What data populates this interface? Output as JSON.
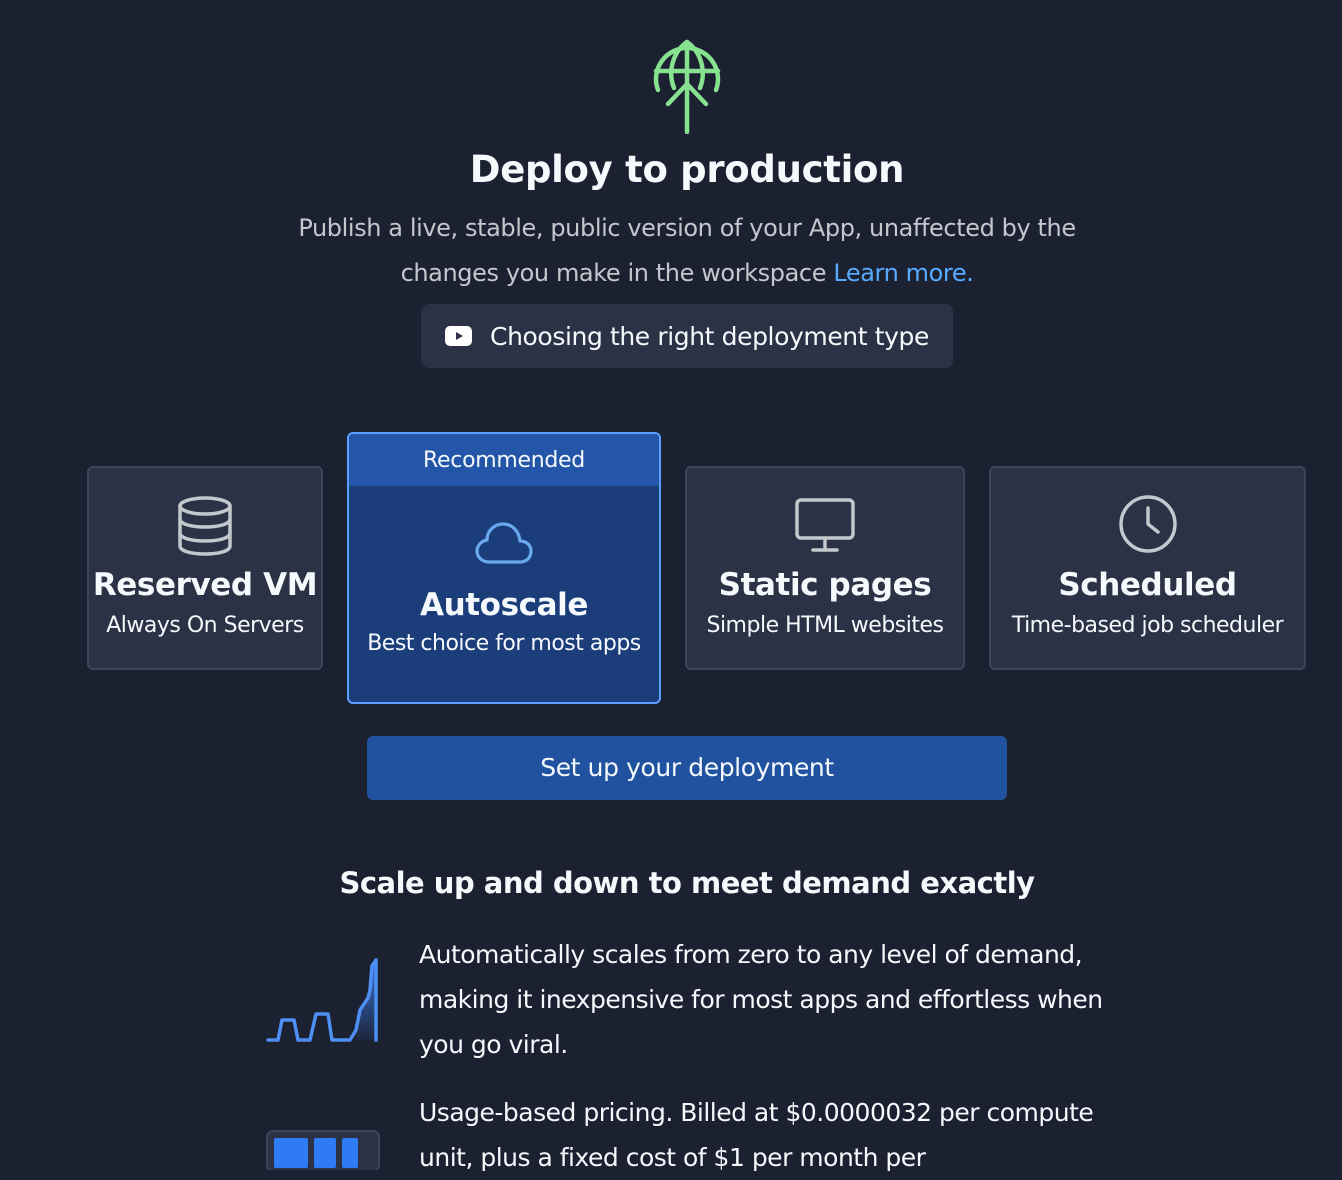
{
  "header": {
    "icon": "globe-upload-icon",
    "title": "Deploy to production",
    "subtitle": "Publish a live, stable, public version of your App, unaffected by the changes you make in the workspace",
    "learn_more": "Learn more.",
    "video_button_label": "Choosing the right deployment type",
    "video_icon": "youtube-icon"
  },
  "deployment_types": [
    {
      "title": "Reserved VM",
      "subtitle": "Always On Servers",
      "icon": "database-icon"
    },
    {
      "title": "Autoscale",
      "subtitle": "Best choice for most apps",
      "icon": "cloud-icon",
      "badge": "Recommended",
      "selected": true
    },
    {
      "title": "Static pages",
      "subtitle": "Simple HTML websites",
      "icon": "monitor-icon"
    },
    {
      "title": "Scheduled",
      "subtitle": "Time-based job scheduler",
      "icon": "clock-icon"
    }
  ],
  "setup_button_label": "Set up your deployment",
  "details": {
    "heading": "Scale up and down to meet demand exactly",
    "features": [
      {
        "icon": "scaling-graph-icon",
        "text": "Automatically scales from zero to any level of demand, making it inexpensive for most apps and effortless when you go viral."
      },
      {
        "icon": "pricing-blocks-icon",
        "text": "Usage-based pricing. Billed at $0.0000032 per compute unit, plus a fixed cost of $1 per month per"
      }
    ]
  },
  "colors": {
    "background": "#1c2132",
    "card": "#2b3245",
    "card_border": "#3c445c",
    "selected_card": "#1b3e7b",
    "selected_border": "#5a9eff",
    "primary_button": "#2052a0",
    "link": "#57abff",
    "hero_icon": "#86e28f"
  }
}
